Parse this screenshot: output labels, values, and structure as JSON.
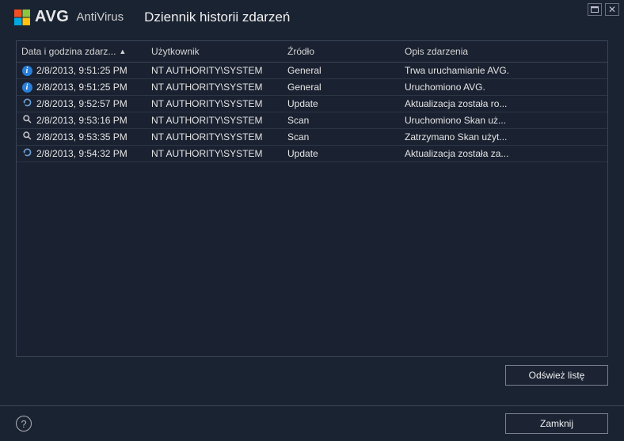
{
  "brand": {
    "name": "AVG",
    "suffix": "AntiVirus"
  },
  "window_title": "Dziennik historii zdarzeń",
  "columns": {
    "date": "Data i godzina zdarz...",
    "user": "Użytkownik",
    "source": "Źródło",
    "desc": "Opis zdarzenia"
  },
  "rows": [
    {
      "icon": "info",
      "date": "2/8/2013, 9:51:25 PM",
      "user": "NT AUTHORITY\\SYSTEM",
      "source": "General",
      "desc": "Trwa uruchamianie AVG."
    },
    {
      "icon": "info",
      "date": "2/8/2013, 9:51:25 PM",
      "user": "NT AUTHORITY\\SYSTEM",
      "source": "General",
      "desc": "Uruchomiono AVG."
    },
    {
      "icon": "refresh",
      "date": "2/8/2013, 9:52:57 PM",
      "user": "NT AUTHORITY\\SYSTEM",
      "source": "Update",
      "desc": "Aktualizacja została ro..."
    },
    {
      "icon": "search",
      "date": "2/8/2013, 9:53:16 PM",
      "user": "NT AUTHORITY\\SYSTEM",
      "source": "Scan",
      "desc": "Uruchomiono Skan uż..."
    },
    {
      "icon": "search",
      "date": "2/8/2013, 9:53:35 PM",
      "user": "NT AUTHORITY\\SYSTEM",
      "source": "Scan",
      "desc": "Zatrzymano Skan użyt..."
    },
    {
      "icon": "refresh",
      "date": "2/8/2013, 9:54:32 PM",
      "user": "NT AUTHORITY\\SYSTEM",
      "source": "Update",
      "desc": "Aktualizacja została za..."
    }
  ],
  "buttons": {
    "refresh_list": "Odśwież listę",
    "close": "Zamknij"
  }
}
